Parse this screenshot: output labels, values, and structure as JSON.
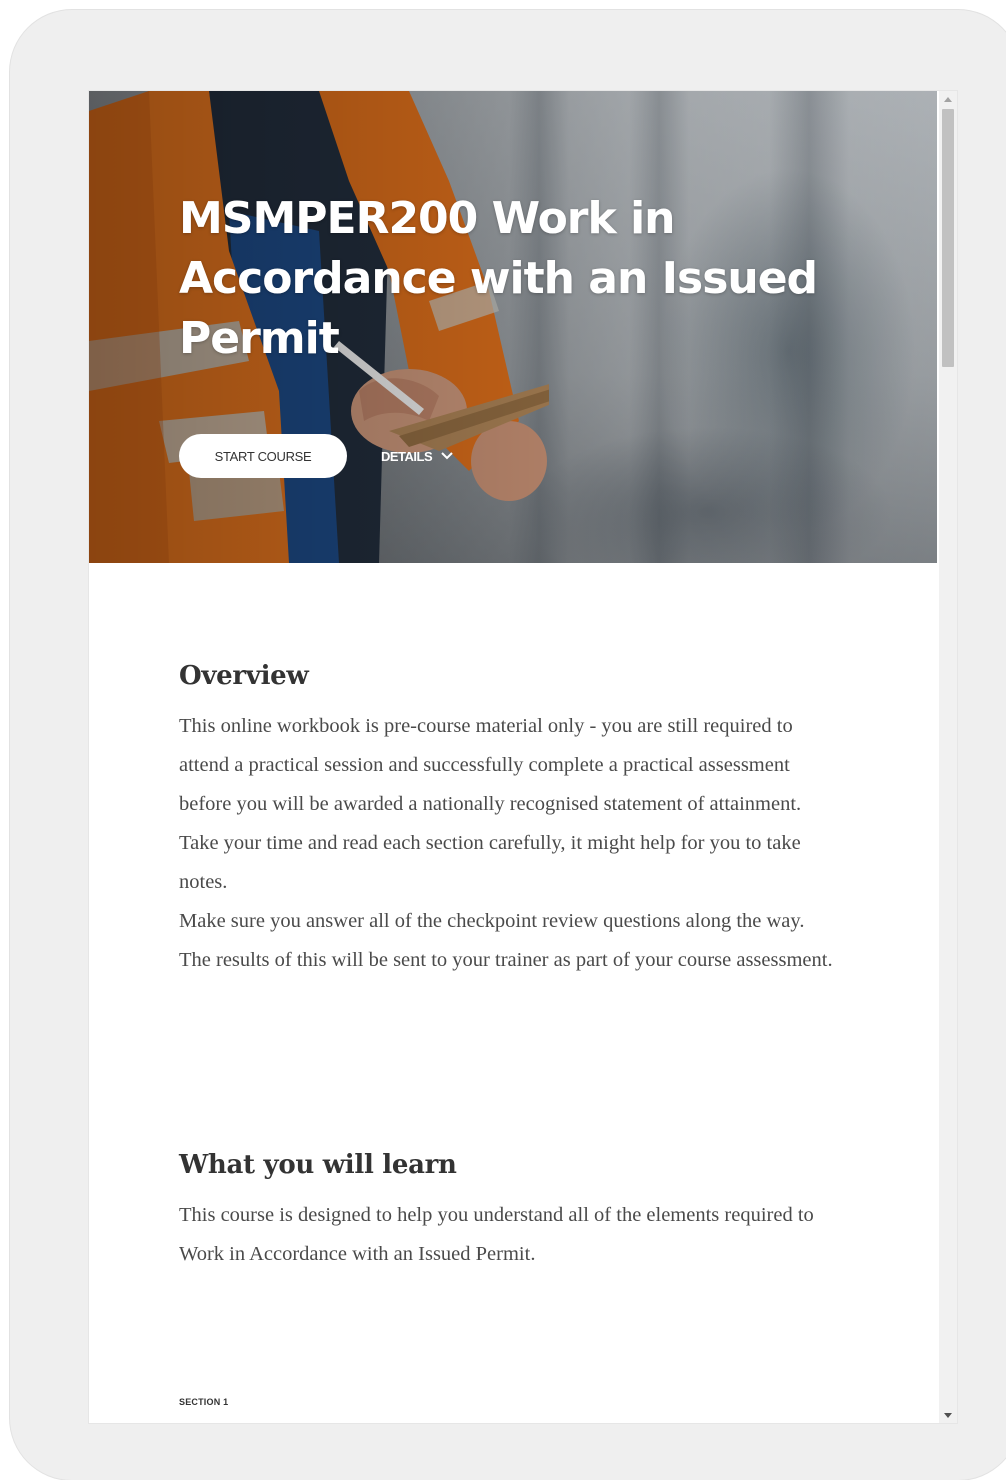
{
  "hero": {
    "title": "MSMPER200 Work in Accordance with an Issued Permit",
    "start_button_label": "START COURSE",
    "details_label": "DETAILS"
  },
  "overview": {
    "heading": "Overview",
    "paragraphs": [
      "This online workbook is pre-course material only - you are still required to attend a practical session and successfully complete a practical assessment before you will be awarded a nationally recognised statement of attainment.",
      "Take your time and read each section carefully, it might help for you to take notes.",
      "Make sure you answer all of the checkpoint review questions along the way.",
      "The results of this will be sent to your trainer as part of your course assessment."
    ]
  },
  "learn": {
    "heading": "What you will learn",
    "paragraph": "This course is designed to help you understand all of the elements required to Work in Accordance with an Issued Permit."
  },
  "section_label": "SECTION 1",
  "icons": {
    "details_chevron": "chevron-down-icon",
    "scroll_up": "triangle-up-icon",
    "scroll_down": "triangle-down-icon"
  },
  "colors": {
    "device_frame": "#efefef",
    "hero_text": "#ffffff",
    "body_text": "#4a4a4a",
    "heading_text": "#333333",
    "safety_orange": "#f07a1f"
  }
}
